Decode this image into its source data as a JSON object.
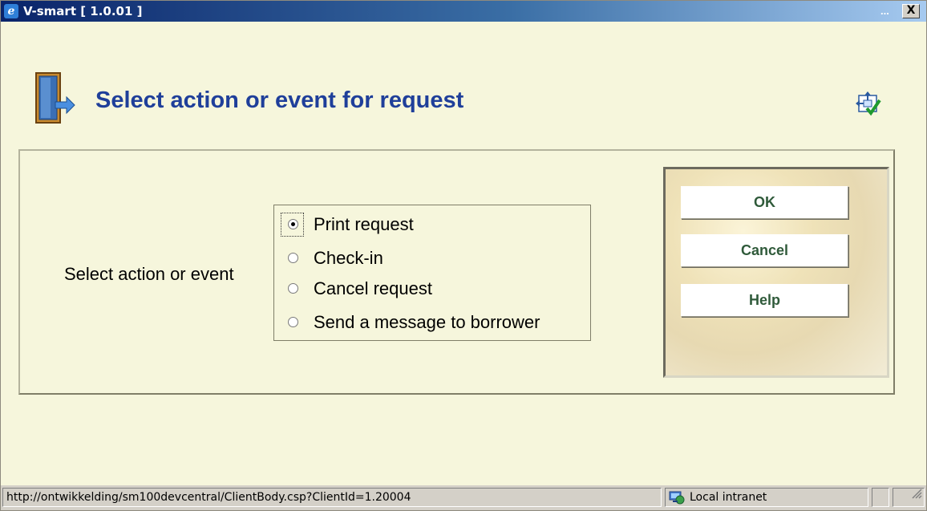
{
  "window": {
    "title": "V-smart [ 1.0.01 ]",
    "dots": "...",
    "close_label": "X"
  },
  "page": {
    "title": "Select action or event for request"
  },
  "form": {
    "label": "Select action or event",
    "options": [
      {
        "label": "Print request",
        "checked": true
      },
      {
        "label": "Check-in",
        "checked": false
      },
      {
        "label": "Cancel request",
        "checked": false
      },
      {
        "label": "Send a message to borrower",
        "checked": false
      }
    ]
  },
  "buttons": {
    "ok": "OK",
    "cancel": "Cancel",
    "help": "Help"
  },
  "statusbar": {
    "url": "http://ontwikkelding/sm100devcentral/ClientBody.csp?ClientId=1.20004",
    "zone": "Local intranet"
  },
  "colors": {
    "titlebar": "#0a246a",
    "background": "#f6f6dc",
    "heading": "#1f3f9a",
    "button_text": "#2f5a3a"
  }
}
